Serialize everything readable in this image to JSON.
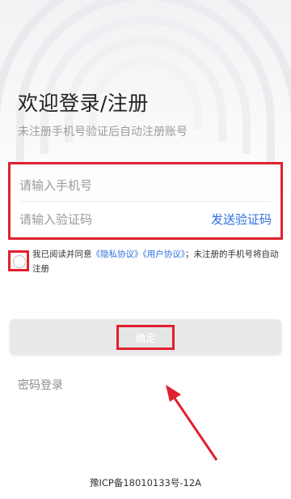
{
  "header": {
    "title": "欢迎登录/注册",
    "subtitle": "未注册手机号验证后自动注册账号"
  },
  "form": {
    "phone_placeholder": "请输入手机号",
    "code_placeholder": "请输入验证码",
    "send_code_label": "发送验证码"
  },
  "agreement": {
    "prefix": "我已阅读并同意",
    "privacy_link": "《隐私协议》",
    "user_link": "《用户协议》",
    "suffix": "；未注册的手机号将自动注册"
  },
  "confirm_label": "确定",
  "password_login_label": "密码登录",
  "footer_icp": "豫ICP备18010133号-12A",
  "colors": {
    "accent_blue": "#2f6fe0",
    "annotation_red": "#e0202f"
  }
}
